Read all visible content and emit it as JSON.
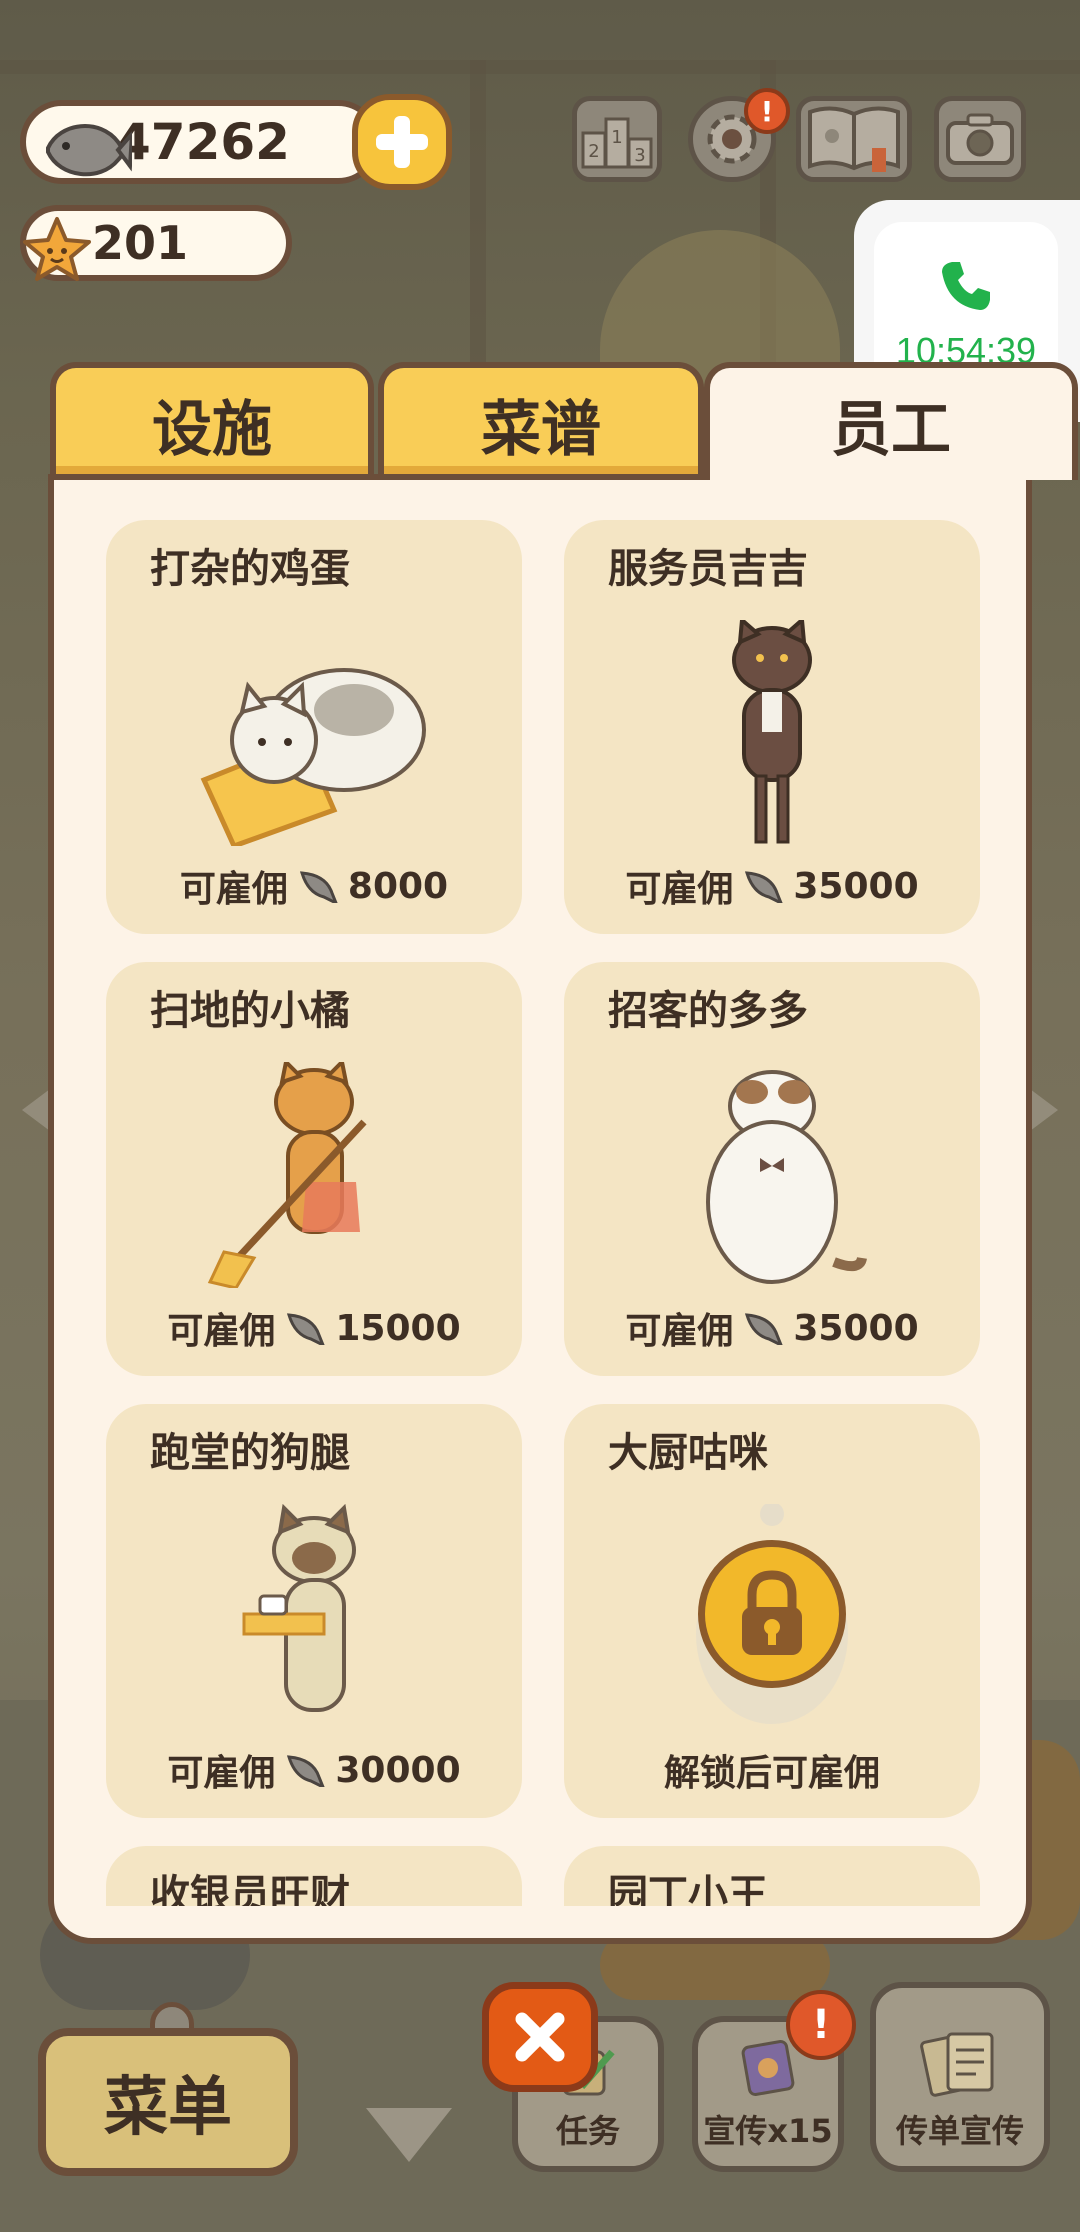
{
  "hud": {
    "fish_count": "47262",
    "star_count": "201",
    "settings_badge": "!",
    "icons": [
      "fish-icon",
      "star-icon",
      "plus-icon",
      "ranking-icon",
      "gear-icon",
      "book-icon",
      "camera-icon"
    ]
  },
  "call_overlay": {
    "time": "10:54:39",
    "icon": "phone-icon",
    "accent": "#22b24c"
  },
  "tabs": [
    {
      "label": "设施",
      "active": false
    },
    {
      "label": "菜谱",
      "active": false
    },
    {
      "label": "员工",
      "active": true
    }
  ],
  "staff": [
    {
      "name": "打杂的鸡蛋",
      "status": "可雇佣",
      "price": "8000",
      "locked": false
    },
    {
      "name": "服务员吉吉",
      "status": "可雇佣",
      "price": "35000",
      "locked": false
    },
    {
      "name": "扫地的小橘",
      "status": "可雇佣",
      "price": "15000",
      "locked": false
    },
    {
      "name": "招客的多多",
      "status": "可雇佣",
      "price": "35000",
      "locked": false
    },
    {
      "name": "跑堂的狗腿",
      "status": "可雇佣",
      "price": "30000",
      "locked": false
    },
    {
      "name": "大厨咕咪",
      "status": "解锁后可雇佣",
      "price": "",
      "locked": true
    },
    {
      "name": "收银员旺财",
      "status": "",
      "price": "",
      "locked": false
    },
    {
      "name": "园丁小王",
      "status": "",
      "price": "",
      "locked": false
    }
  ],
  "bottom_bar": {
    "menu_label": "菜单",
    "task_label": "任务",
    "promo_label": "宣传x15",
    "flyer_label": "传单宣传",
    "promo_badge": "!"
  },
  "colors": {
    "tab_yellow": "#f9cd57",
    "panel_bg": "#fdf3e7",
    "card_bg": "#f4e5c4",
    "outline_brown": "#6b4e3a",
    "close_orange": "#e35a15"
  }
}
